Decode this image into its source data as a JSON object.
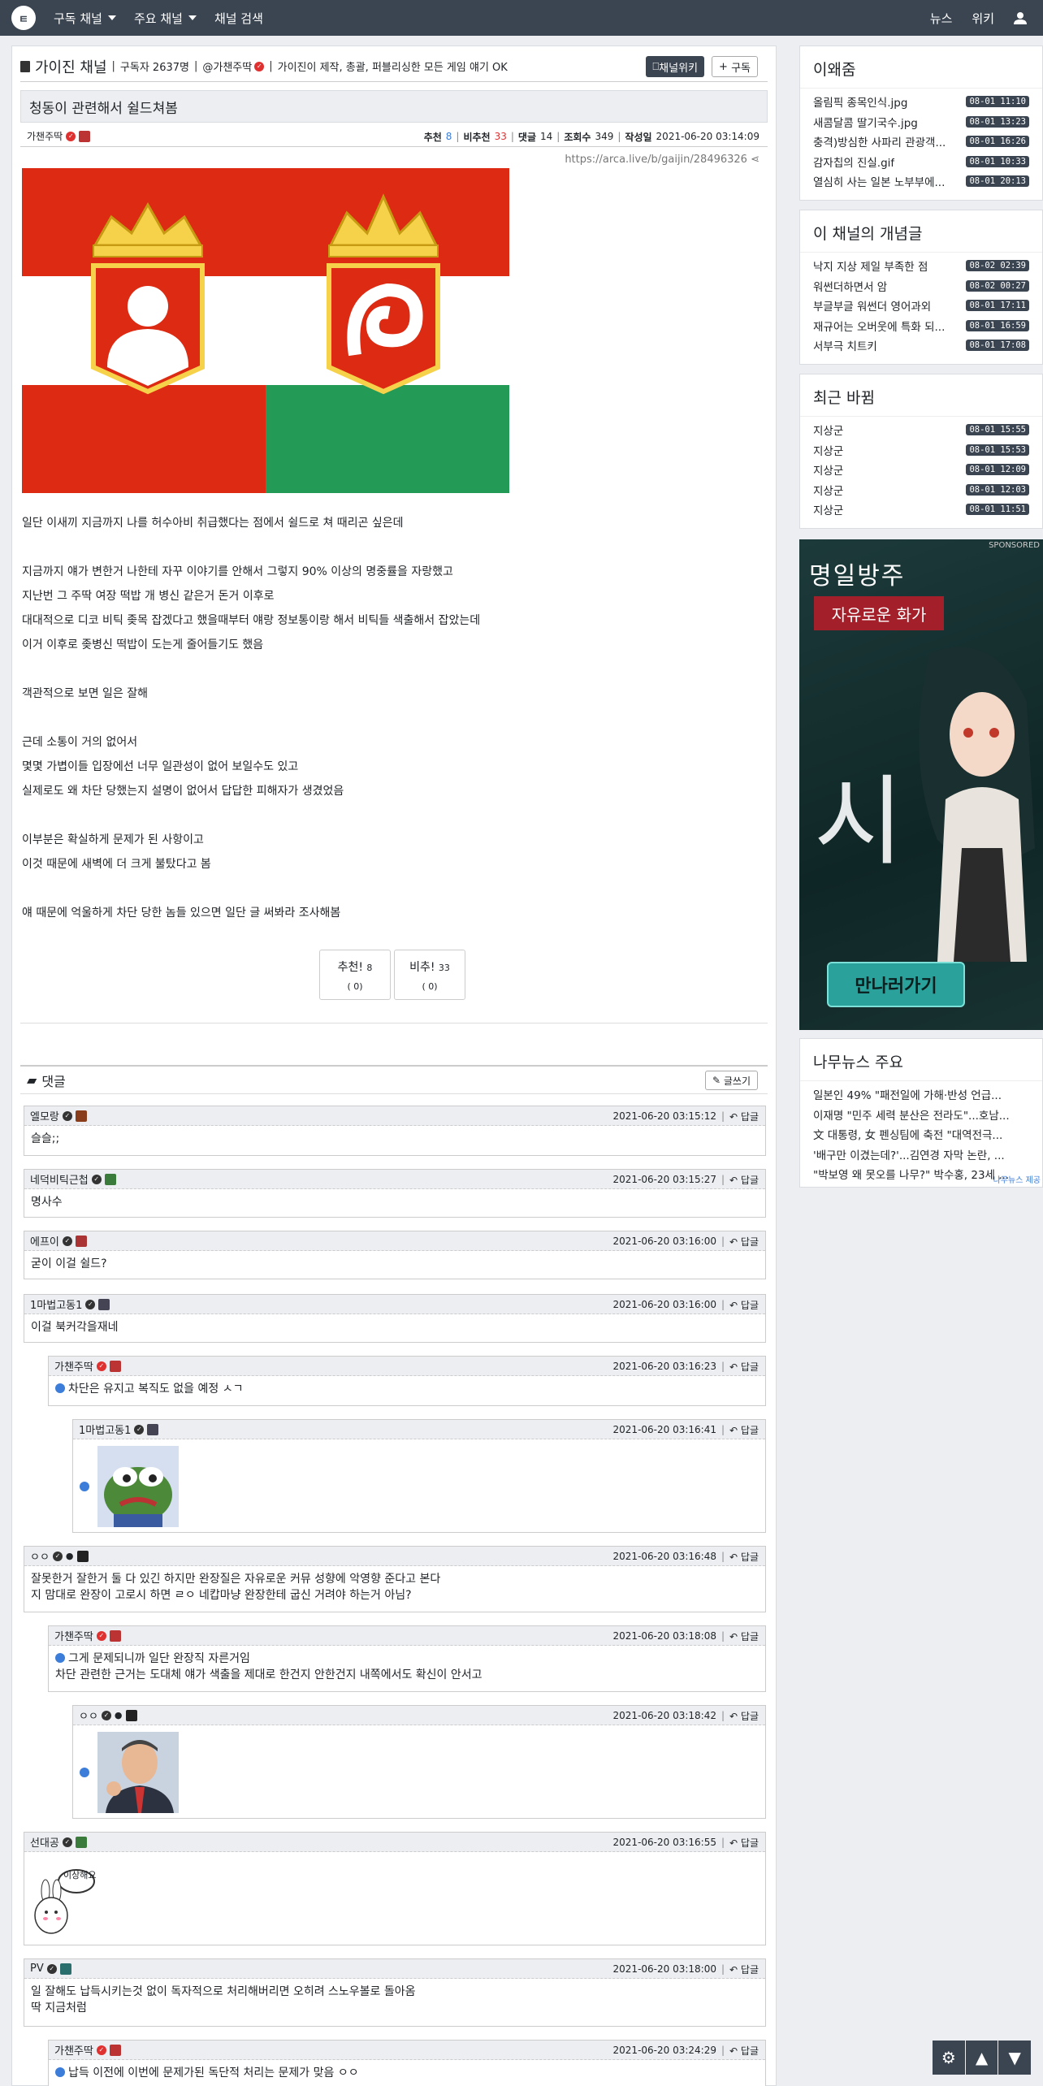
{
  "nav": {
    "logo": "ㅌ",
    "items": [
      "구독 채널",
      "주요 채널",
      "채널 검색"
    ],
    "right": [
      "뉴스",
      "위키"
    ]
  },
  "channel": {
    "name": "가이진 채널",
    "subs": "구독자 2637명",
    "owner": "@가챈주딱",
    "desc": "가이진이 제작, 총괄, 퍼블리싱한 모든 게임 얘기 OK",
    "wiki": "채널위키",
    "subscribe": "구독"
  },
  "article": {
    "title": "청동이 관련해서 쉴드쳐봄",
    "author": "가챈주딱",
    "rec_label": "추천",
    "rec": "8",
    "unrec_label": "비추천",
    "unrec": "33",
    "cmt_label": "댓글",
    "cmt": "14",
    "views_label": "조회수",
    "views": "349",
    "date_label": "작성일",
    "date": "2021-06-20 03:14:09",
    "link": "https://arca.live/b/gaijin/28496326",
    "lines": [
      "일단 이새끼 지금까지 나를 허수아비 취급했다는 점에서 쉴드로 쳐 때리곤 싶은데",
      "",
      "지금까지 얘가 변한거 나한테 자꾸 이야기를 안해서 그렇지 90% 이상의 명중률을 자랑했고",
      "지난번 그 주딱 여장 떡밥 개 병신 같은거 돈거 이후로",
      "대대적으로 디코 비틱 좆목 잡겠다고 했을때부터 얘랑 정보통이랑 해서 비틱들 색출해서 잡았는데",
      "이거 이후로 좆병신 떡밥이 도는게 줄어들기도 했음",
      "",
      "객관적으로 보면 일은 잘해",
      "",
      "근데 소통이 거의 없어서",
      "몇몇 가볍이들 입장에선 너무 일관성이 없어 보일수도 있고",
      "실제로도 왜 차단 당했는지 설명이 없어서 답답한 피해자가 생겼었음",
      "",
      "이부분은 확실하게 문제가 된 사항이고",
      "이것 때문에 새벽에 더 크게 불탔다고 봄",
      "",
      "얘 때문에 억울하게 차단 당한 놈들 있으면 일단 글 써봐라 조사해봄"
    ],
    "vote_up": "추천!",
    "vote_up_n": "8",
    "vote_down": "비추!",
    "vote_down_n": "33",
    "vote_sub": "( 0)"
  },
  "comments": {
    "title": "댓글",
    "write": "글쓰기",
    "reply": "답글",
    "items": [
      {
        "author": "엘모랑",
        "date": "2021-06-20 03:15:12",
        "text": "슬슬;;"
      },
      {
        "author": "네덕비틱근첩",
        "date": "2021-06-20 03:15:27",
        "text": "명사수"
      },
      {
        "author": "에프이",
        "date": "2021-06-20 03:16:00",
        "text": "굳이 이걸 쉴드?"
      },
      {
        "author": "1마법고동1",
        "date": "2021-06-20 03:16:00",
        "text": "이걸 북커각을재네"
      },
      {
        "author": "가챈주딱",
        "date": "2021-06-20 03:16:23",
        "text": "차단은 유지고 복직도 없을 예정 ㅅㄱ"
      },
      {
        "author": "1마법고동1",
        "date": "2021-06-20 03:16:41",
        "text": ""
      },
      {
        "author": "ㅇㅇ",
        "date": "2021-06-20 03:16:48",
        "text": "잘못한거 잘한거 둘 다 있긴 하지만 완장질은 자유로운 커뮤 성향에 악영향 준다고 본다",
        "text2": "지 맘대로 완장이 고로시 하면 ㄹㅇ 네캅마냥 완장한테 굽신 거려야 하는거 아님?"
      },
      {
        "author": "가챈주딱",
        "date": "2021-06-20 03:18:08",
        "text": "그게 문제되니까 일단 완장직 자른거임",
        "text2": "차단 관련한 근거는 도대체 얘가 색출을 제대로 한건지 안한건지 내쪽에서도 확신이 안서고"
      },
      {
        "author": "ㅇㅇ",
        "date": "2021-06-20 03:18:42",
        "text": ""
      },
      {
        "author": "선대공",
        "date": "2021-06-20 03:16:55",
        "text": "",
        "sticker": "이상해요"
      },
      {
        "author": "PV",
        "date": "2021-06-20 03:18:00",
        "text": "일 잘해도 납득시키는것 없이 독자적으로 처리해버리면 오히려 스노우볼로 돌아옴",
        "text2": "딱 지금처럼"
      },
      {
        "author": "가챈주딱",
        "date": "2021-06-20 03:24:29",
        "text": "납득 이전에 이번에 문제가된 독단적 처리는 문제가 맞음 ㅇㅇ"
      }
    ]
  },
  "sidebar": {
    "hot": {
      "title": "이왜줌",
      "items": [
        [
          "올림픽 종목인식.jpg",
          "08-01 11:10"
        ],
        [
          "새콤달콤 딸기국수.jpg",
          "08-01 13:23"
        ],
        [
          "충격)방심한 사파리 관광객...",
          "08-01 16:26"
        ],
        [
          "감자칩의 진실.gif",
          "08-01 10:33"
        ],
        [
          "열심히 사는 일본 노부부에...",
          "08-01 20:13"
        ]
      ]
    },
    "best": {
      "title": "이 채널의 개념글",
      "items": [
        [
          "낙지 지상 제일 부족한 점",
          "08-02 02:39"
        ],
        [
          "워썬더하면서 암",
          "08-02 00:27"
        ],
        [
          "부글부글 워썬더 영어과외",
          "08-01 17:11"
        ],
        [
          "재규어는 오버웃에 특화 되...",
          "08-01 16:59"
        ],
        [
          "서부극 치트키",
          "08-01 17:08"
        ]
      ]
    },
    "recent": {
      "title": "최근 바뀜",
      "items": [
        [
          "지상군",
          "08-01 15:55"
        ],
        [
          "지상군",
          "08-01 15:53"
        ],
        [
          "지상군",
          "08-01 12:09"
        ],
        [
          "지상군",
          "08-01 12:03"
        ],
        [
          "지상군",
          "08-01 11:51"
        ]
      ]
    },
    "ad": {
      "sponsored": "SPONSORED",
      "title": "명일방주",
      "label": "자유로운 화가",
      "big": "시",
      "button": "만나러가기"
    },
    "news": {
      "title": "나무뉴스 주요",
      "credit": "나무뉴스 제공",
      "items": [
        "일본인 49% \"패전일에 가해·반성 언급...",
        "이재명 \"민주 세력 분산은 전라도\"...호남...",
        "文 대통령, 女 펜싱팀에 축전 \"대역전극...",
        "'배구만 이겼는데?'...김연경 자막 논란, ...",
        "\"박보영 왜 못오를 나무?\" 박수홍, 23세 ..."
      ]
    }
  }
}
